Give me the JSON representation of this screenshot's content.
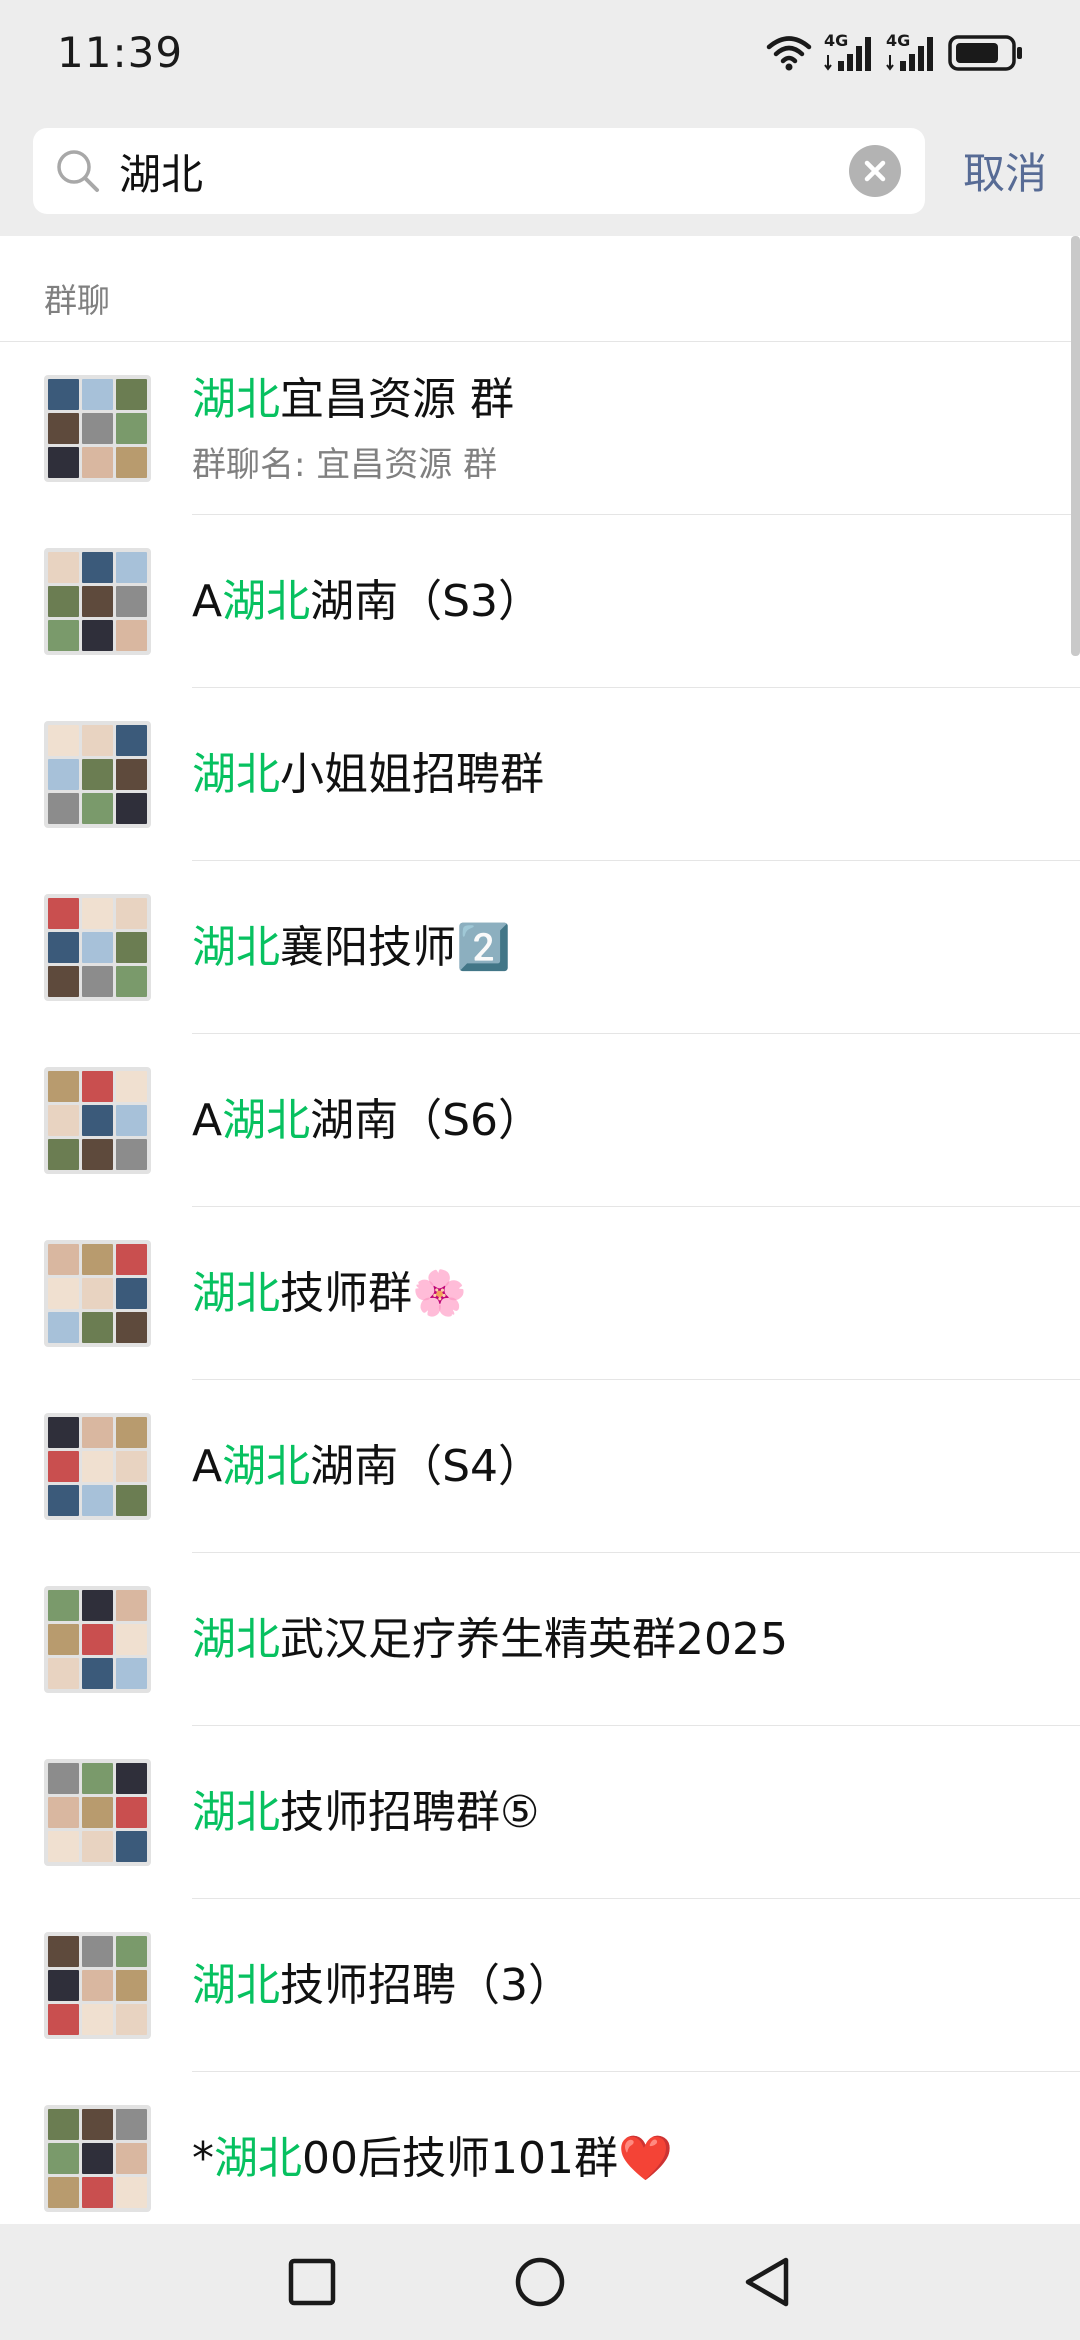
{
  "status_bar": {
    "time": "11:39",
    "network_1": "4G",
    "network_2": "4G",
    "icons": [
      "wifi-icon",
      "signal-icon",
      "signal-icon",
      "battery-icon"
    ]
  },
  "search": {
    "value": "湖北",
    "placeholder": "搜索",
    "cancel_label": "取消"
  },
  "colors": {
    "highlight": "#07c160",
    "link": "#576b95",
    "header_bg": "#ededed"
  },
  "results": {
    "section_title": "群聊",
    "items": [
      {
        "prefix": "",
        "highlight": "湖北",
        "suffix": "宜昌资源  群",
        "subtitle": "群聊名: 宜昌资源  群"
      },
      {
        "prefix": "A",
        "highlight": "湖北",
        "suffix": "湖南（S3）",
        "subtitle": ""
      },
      {
        "prefix": "",
        "highlight": "湖北",
        "suffix": "小姐姐招聘群",
        "subtitle": ""
      },
      {
        "prefix": "",
        "highlight": "湖北",
        "suffix": "襄阳技师2️⃣",
        "subtitle": ""
      },
      {
        "prefix": "A",
        "highlight": "湖北",
        "suffix": "湖南（S6）",
        "subtitle": ""
      },
      {
        "prefix": "",
        "highlight": "湖北",
        "suffix": "技师群🌸",
        "subtitle": ""
      },
      {
        "prefix": "A",
        "highlight": "湖北",
        "suffix": "湖南（S4）",
        "subtitle": ""
      },
      {
        "prefix": "",
        "highlight": "湖北",
        "suffix": "武汉足疗养生精英群2025",
        "subtitle": ""
      },
      {
        "prefix": "",
        "highlight": "湖北",
        "suffix": "技师招聘群⑤",
        "subtitle": ""
      },
      {
        "prefix": "",
        "highlight": "湖北",
        "suffix": "技师招聘（3）",
        "subtitle": ""
      },
      {
        "prefix": "*",
        "highlight": "湖北",
        "suffix": "00后技师101群❤️",
        "subtitle": ""
      }
    ]
  },
  "nav_bar": {
    "buttons": [
      "recents-square-icon",
      "home-circle-icon",
      "back-triangle-icon"
    ]
  }
}
